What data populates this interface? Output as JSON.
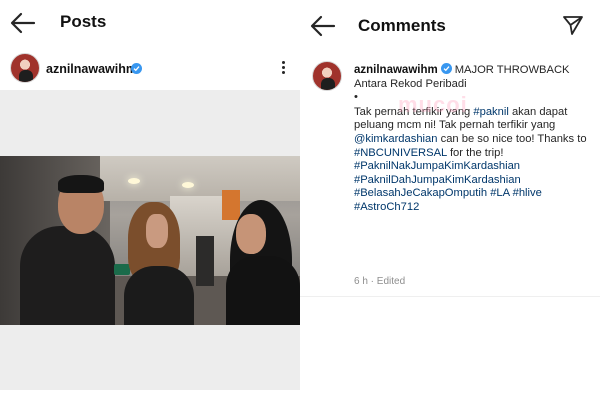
{
  "posts_screen": {
    "title": "Posts",
    "username": "aznilnawawihm"
  },
  "comments_screen": {
    "title": "Comments",
    "username": "aznilnawawihm",
    "caption_line1": "MAJOR THROWBACK",
    "caption_line2": "Antara Rekod Peribadi",
    "caption_dot": "•",
    "body": {
      "t1": "Tak pernah terfikir yang ",
      "tag_paknil": "#paknil",
      "t2": " akan dapat peluang mcm ni! Tak pernah terfikir yang ",
      "mention_kim": "@kimkardashian",
      "t3": " can be so nice too! Thanks to ",
      "tag_nbc": "#NBCUNIVERSAL",
      "t4": " for the trip! ",
      "tag_nak": "#PaknilNakJumpaKimKardashian",
      "tag_dah": "#PaknilDahJumpaKimKardashian",
      "tag_belasah": "#BelasahJeCakapOmputih",
      "tag_la": "#LA",
      "tag_hlive": "#hlive",
      "tag_astro": "#AstroCh712"
    },
    "meta": "6 h · Edited"
  },
  "watermark_text": "mucoi",
  "colors": {
    "link": "#00376b",
    "verified": "#3897f0",
    "meta": "#8e8e8e"
  }
}
